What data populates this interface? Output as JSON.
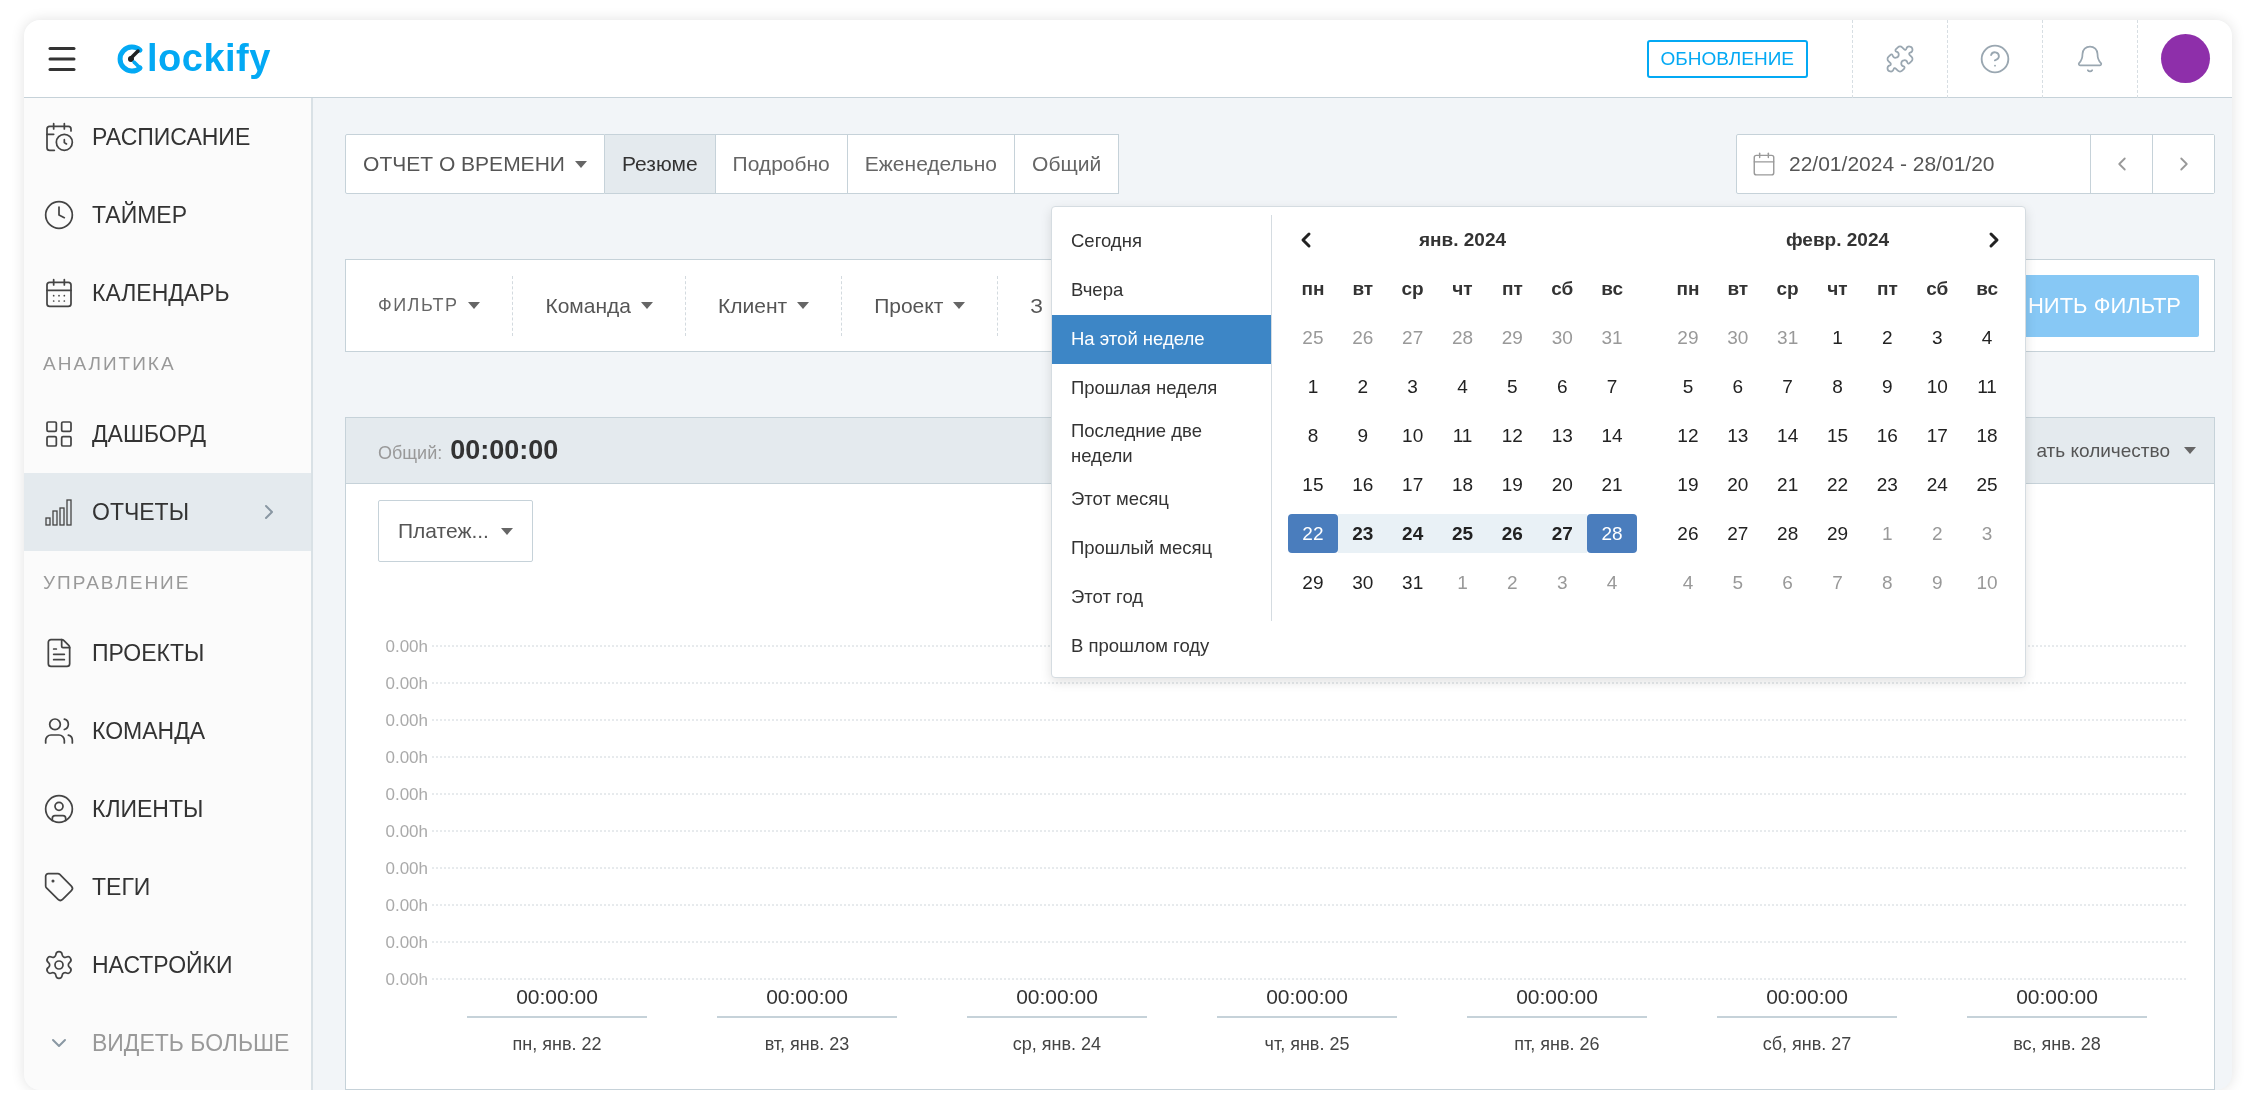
{
  "header": {
    "logo": "lockify",
    "update_button": "ОБНОВЛЕНИЕ"
  },
  "sidebar": {
    "groups": [
      {
        "items": [
          {
            "label": "РАСПИСАНИЕ",
            "selected": false,
            "expandable": false
          },
          {
            "label": "ТАЙМЕР",
            "selected": false,
            "expandable": false
          },
          {
            "label": "КАЛЕНДАРЬ",
            "selected": false,
            "expandable": false
          }
        ]
      },
      {
        "heading": "АНАЛИТИКА",
        "items": [
          {
            "label": "ДАШБОРД",
            "selected": false,
            "expandable": false
          },
          {
            "label": "ОТЧЕТЫ",
            "selected": true,
            "expandable": true
          }
        ]
      },
      {
        "heading": "УПРАВЛЕНИЕ",
        "items": [
          {
            "label": "ПРОЕКТЫ",
            "selected": false,
            "expandable": false
          },
          {
            "label": "КОМАНДА",
            "selected": false,
            "expandable": false
          },
          {
            "label": "КЛИЕНТЫ",
            "selected": false,
            "expandable": false
          },
          {
            "label": "ТЕГИ",
            "selected": false,
            "expandable": false
          },
          {
            "label": "НАСТРОЙКИ",
            "selected": false,
            "expandable": false
          }
        ]
      }
    ],
    "more": "ВИДЕТЬ БОЛЬШЕ"
  },
  "report_bar": {
    "report_type": "ОТЧЕТ О ВРЕМЕНИ",
    "tabs": [
      {
        "label": "Резюме",
        "selected": true
      },
      {
        "label": "Подробно",
        "selected": false
      },
      {
        "label": "Еженедельно",
        "selected": false
      },
      {
        "label": "Общий",
        "selected": false
      }
    ]
  },
  "date_range": {
    "value": "22/01/2024 - 28/01/20"
  },
  "filter_bar": {
    "filters": [
      {
        "label": "ФИЛЬТР",
        "kind": "heading"
      },
      {
        "label": "Команда",
        "kind": "dropdown"
      },
      {
        "label": "Клиент",
        "kind": "dropdown"
      },
      {
        "label": "Проект",
        "kind": "dropdown"
      },
      {
        "label": "З",
        "kind": "text"
      }
    ],
    "apply_button": "НИТЬ ФИЛЬТР"
  },
  "summary": {
    "total_label": "Общий:",
    "total": "00:00:00",
    "count_dropdown": "ать количество",
    "group_dropdown": "Платеж...",
    "chart_data": {
      "type": "bar",
      "categories": [
        "пн, янв. 22",
        "вт, янв. 23",
        "ср, янв. 24",
        "чт, янв. 25",
        "пт, янв. 26",
        "сб, янв. 27",
        "вс, янв. 28"
      ],
      "values": [
        0,
        0,
        0,
        0,
        0,
        0,
        0
      ],
      "value_labels": [
        "00:00:00",
        "00:00:00",
        "00:00:00",
        "00:00:00",
        "00:00:00",
        "00:00:00",
        "00:00:00"
      ],
      "ylim": [
        0,
        0.0009
      ],
      "grid": true,
      "yticks": [
        {
          "value": 0,
          "label": "0.00h"
        },
        {
          "value": 0.0001,
          "label": "0.00h"
        },
        {
          "value": 0.0002,
          "label": "0.00h"
        },
        {
          "value": 0.0003,
          "label": "0.00h"
        },
        {
          "value": 0.0004,
          "label": "0.00h"
        },
        {
          "value": 0.0005,
          "label": "0.00h"
        },
        {
          "value": 0.0006,
          "label": "0.00h"
        },
        {
          "value": 0.0007,
          "label": "0.00h"
        },
        {
          "value": 0.0008,
          "label": "0.00h"
        },
        {
          "value": 0.0009,
          "label": "0.00h"
        }
      ]
    }
  },
  "date_picker": {
    "presets": [
      {
        "label": "Сегодня",
        "selected": false
      },
      {
        "label": "Вчера",
        "selected": false
      },
      {
        "label": "На этой неделе",
        "selected": true
      },
      {
        "label": "Прошлая неделя",
        "selected": false
      },
      {
        "label": "Последние две недели",
        "selected": false
      },
      {
        "label": "Этот месяц",
        "selected": false
      },
      {
        "label": "Прошлый месяц",
        "selected": false
      },
      {
        "label": "Этот год",
        "selected": false
      },
      {
        "label": "В прошлом году",
        "selected": false
      }
    ],
    "months": [
      {
        "title": "янв. 2024",
        "weekdays": [
          "пн",
          "вт",
          "ср",
          "чт",
          "пт",
          "сб",
          "вс"
        ],
        "weeks": [
          [
            {
              "day": "25",
              "outside": true,
              "selected": false,
              "in_range": false
            },
            {
              "day": "26",
              "outside": true,
              "selected": false,
              "in_range": false
            },
            {
              "day": "27",
              "outside": true,
              "selected": false,
              "in_range": false
            },
            {
              "day": "28",
              "outside": true,
              "selected": false,
              "in_range": false
            },
            {
              "day": "29",
              "outside": true,
              "selected": false,
              "in_range": false
            },
            {
              "day": "30",
              "outside": true,
              "selected": false,
              "in_range": false
            },
            {
              "day": "31",
              "outside": true,
              "selected": false,
              "in_range": false
            }
          ],
          [
            {
              "day": "1",
              "outside": false,
              "selected": false,
              "in_range": false
            },
            {
              "day": "2",
              "outside": false,
              "selected": false,
              "in_range": false
            },
            {
              "day": "3",
              "outside": false,
              "selected": false,
              "in_range": false
            },
            {
              "day": "4",
              "outside": false,
              "selected": false,
              "in_range": false
            },
            {
              "day": "5",
              "outside": false,
              "selected": false,
              "in_range": false
            },
            {
              "day": "6",
              "outside": false,
              "selected": false,
              "in_range": false
            },
            {
              "day": "7",
              "outside": false,
              "selected": false,
              "in_range": false
            }
          ],
          [
            {
              "day": "8",
              "outside": false,
              "selected": false,
              "in_range": false
            },
            {
              "day": "9",
              "outside": false,
              "selected": false,
              "in_range": false
            },
            {
              "day": "10",
              "outside": false,
              "selected": false,
              "in_range": false
            },
            {
              "day": "11",
              "outside": false,
              "selected": false,
              "in_range": false
            },
            {
              "day": "12",
              "outside": false,
              "selected": false,
              "in_range": false
            },
            {
              "day": "13",
              "outside": false,
              "selected": false,
              "in_range": false
            },
            {
              "day": "14",
              "outside": false,
              "selected": false,
              "in_range": false
            }
          ],
          [
            {
              "day": "15",
              "outside": false,
              "selected": false,
              "in_range": false
            },
            {
              "day": "16",
              "outside": false,
              "selected": false,
              "in_range": false
            },
            {
              "day": "17",
              "outside": false,
              "selected": false,
              "in_range": false
            },
            {
              "day": "18",
              "outside": false,
              "selected": false,
              "in_range": false
            },
            {
              "day": "19",
              "outside": false,
              "selected": false,
              "in_range": false
            },
            {
              "day": "20",
              "outside": false,
              "selected": false,
              "in_range": false
            },
            {
              "day": "21",
              "outside": false,
              "selected": false,
              "in_range": false
            }
          ],
          [
            {
              "day": "22",
              "outside": false,
              "selected": true,
              "in_range": true
            },
            {
              "day": "23",
              "outside": false,
              "selected": false,
              "in_range": true
            },
            {
              "day": "24",
              "outside": false,
              "selected": false,
              "in_range": true
            },
            {
              "day": "25",
              "outside": false,
              "selected": false,
              "in_range": true
            },
            {
              "day": "26",
              "outside": false,
              "selected": false,
              "in_range": true
            },
            {
              "day": "27",
              "outside": false,
              "selected": false,
              "in_range": true
            },
            {
              "day": "28",
              "outside": false,
              "selected": true,
              "in_range": true
            }
          ],
          [
            {
              "day": "29",
              "outside": false,
              "selected": false,
              "in_range": false
            },
            {
              "day": "30",
              "outside": false,
              "selected": false,
              "in_range": false
            },
            {
              "day": "31",
              "outside": false,
              "selected": false,
              "in_range": false
            },
            {
              "day": "1",
              "outside": true,
              "selected": false,
              "in_range": false
            },
            {
              "day": "2",
              "outside": true,
              "selected": false,
              "in_range": false
            },
            {
              "day": "3",
              "outside": true,
              "selected": false,
              "in_range": false
            },
            {
              "day": "4",
              "outside": true,
              "selected": false,
              "in_range": false
            }
          ]
        ]
      },
      {
        "title": "февр. 2024",
        "weekdays": [
          "пн",
          "вт",
          "ср",
          "чт",
          "пт",
          "сб",
          "вс"
        ],
        "weeks": [
          [
            {
              "day": "29",
              "outside": true,
              "selected": false,
              "in_range": false
            },
            {
              "day": "30",
              "outside": true,
              "selected": false,
              "in_range": false
            },
            {
              "day": "31",
              "outside": true,
              "selected": false,
              "in_range": false
            },
            {
              "day": "1",
              "outside": false,
              "selected": false,
              "in_range": false
            },
            {
              "day": "2",
              "outside": false,
              "selected": false,
              "in_range": false
            },
            {
              "day": "3",
              "outside": false,
              "selected": false,
              "in_range": false
            },
            {
              "day": "4",
              "outside": false,
              "selected": false,
              "in_range": false
            }
          ],
          [
            {
              "day": "5",
              "outside": false,
              "selected": false,
              "in_range": false
            },
            {
              "day": "6",
              "outside": false,
              "selected": false,
              "in_range": false
            },
            {
              "day": "7",
              "outside": false,
              "selected": false,
              "in_range": false
            },
            {
              "day": "8",
              "outside": false,
              "selected": false,
              "in_range": false
            },
            {
              "day": "9",
              "outside": false,
              "selected": false,
              "in_range": false
            },
            {
              "day": "10",
              "outside": false,
              "selected": false,
              "in_range": false
            },
            {
              "day": "11",
              "outside": false,
              "selected": false,
              "in_range": false
            }
          ],
          [
            {
              "day": "12",
              "outside": false,
              "selected": false,
              "in_range": false
            },
            {
              "day": "13",
              "outside": false,
              "selected": false,
              "in_range": false
            },
            {
              "day": "14",
              "outside": false,
              "selected": false,
              "in_range": false
            },
            {
              "day": "15",
              "outside": false,
              "selected": false,
              "in_range": false
            },
            {
              "day": "16",
              "outside": false,
              "selected": false,
              "in_range": false
            },
            {
              "day": "17",
              "outside": false,
              "selected": false,
              "in_range": false
            },
            {
              "day": "18",
              "outside": false,
              "selected": false,
              "in_range": false
            }
          ],
          [
            {
              "day": "19",
              "outside": false,
              "selected": false,
              "in_range": false
            },
            {
              "day": "20",
              "outside": false,
              "selected": false,
              "in_range": false
            },
            {
              "day": "21",
              "outside": false,
              "selected": false,
              "in_range": false
            },
            {
              "day": "22",
              "outside": false,
              "selected": false,
              "in_range": false
            },
            {
              "day": "23",
              "outside": false,
              "selected": false,
              "in_range": false
            },
            {
              "day": "24",
              "outside": false,
              "selected": false,
              "in_range": false
            },
            {
              "day": "25",
              "outside": false,
              "selected": false,
              "in_range": false
            }
          ],
          [
            {
              "day": "26",
              "outside": false,
              "selected": false,
              "in_range": false
            },
            {
              "day": "27",
              "outside": false,
              "selected": false,
              "in_range": false
            },
            {
              "day": "28",
              "outside": false,
              "selected": false,
              "in_range": false
            },
            {
              "day": "29",
              "outside": false,
              "selected": false,
              "in_range": false
            },
            {
              "day": "1",
              "outside": true,
              "selected": false,
              "in_range": false
            },
            {
              "day": "2",
              "outside": true,
              "selected": false,
              "in_range": false
            },
            {
              "day": "3",
              "outside": true,
              "selected": false,
              "in_range": false
            }
          ],
          [
            {
              "day": "4",
              "outside": true,
              "selected": false,
              "in_range": false
            },
            {
              "day": "5",
              "outside": true,
              "selected": false,
              "in_range": false
            },
            {
              "day": "6",
              "outside": true,
              "selected": false,
              "in_range": false
            },
            {
              "day": "7",
              "outside": true,
              "selected": false,
              "in_range": false
            },
            {
              "day": "8",
              "outside": true,
              "selected": false,
              "in_range": false
            },
            {
              "day": "9",
              "outside": true,
              "selected": false,
              "in_range": false
            },
            {
              "day": "10",
              "outside": true,
              "selected": false,
              "in_range": false
            }
          ]
        ]
      }
    ]
  }
}
